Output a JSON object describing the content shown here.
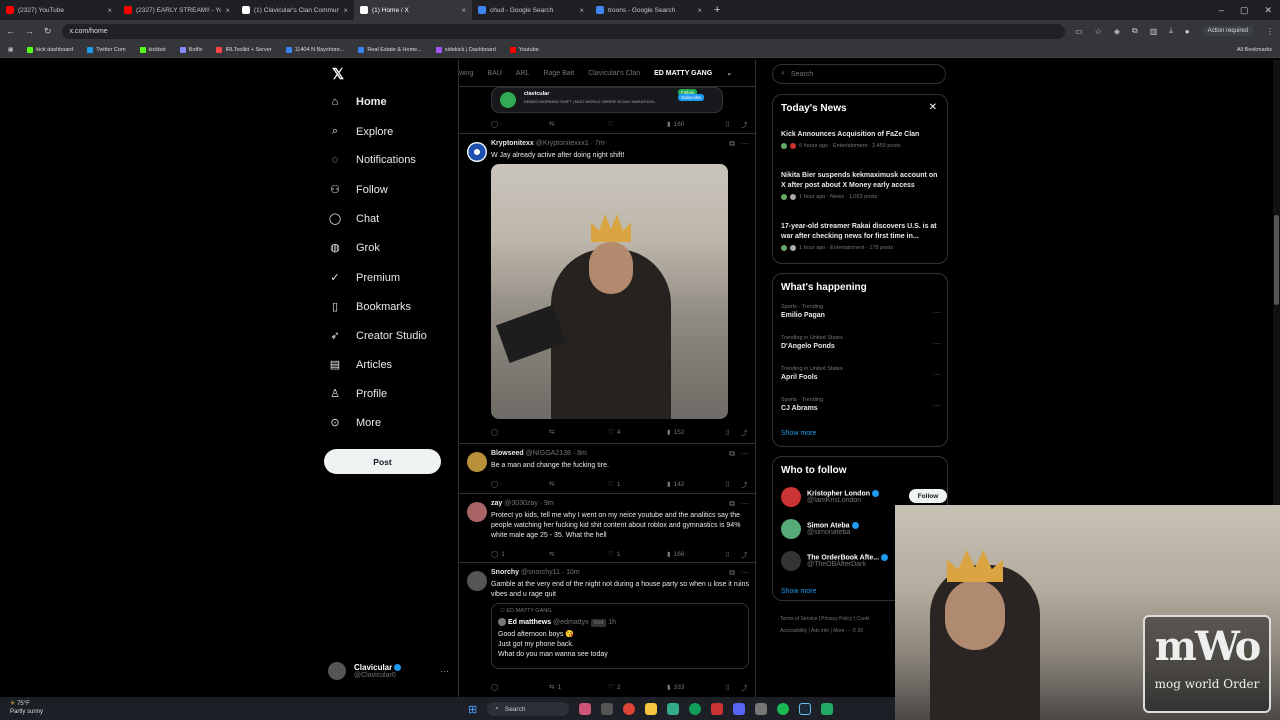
{
  "browser": {
    "tabs": [
      {
        "label": "(2327) YouTube",
        "color": "#ff0000"
      },
      {
        "label": "(2327) EARLY STREAM!! - Yo",
        "color": "#ff0000"
      },
      {
        "label": "(1) Clavicular's Clan Communit",
        "color": "#ffffff"
      },
      {
        "label": "(1) Home / X",
        "color": "#ffffff"
      },
      {
        "label": "chud - Google Search",
        "color": "#4285f4"
      },
      {
        "label": "troons - Google Search",
        "color": "#4285f4"
      }
    ],
    "url": "x.com/home",
    "action_required": "Action required",
    "bookmarks": [
      {
        "label": "kick dashboard",
        "color": "#53fc18"
      },
      {
        "label": "Twitter Com",
        "color": "#1d9bf0"
      },
      {
        "label": "kickbot",
        "color": "#53fc18"
      },
      {
        "label": "Botfix",
        "color": "#8888ff"
      },
      {
        "label": "IRLToolkit + Server",
        "color": "#ff4444"
      },
      {
        "label": "11404 N Bayshore...",
        "color": "#3b82f6"
      },
      {
        "label": "Real Estate & Home...",
        "color": "#3b82f6"
      },
      {
        "label": "sidekick | Dashboard",
        "color": "#a855f7"
      },
      {
        "label": "Youtube",
        "color": "#ff0000"
      }
    ],
    "all_bookmarks": "All Bookmarks"
  },
  "nav": {
    "items": [
      {
        "label": "Home",
        "icon": "home-icon",
        "glyph": "⌂"
      },
      {
        "label": "Explore",
        "icon": "search-icon",
        "glyph": "⌕"
      },
      {
        "label": "Notifications",
        "icon": "bell-icon",
        "glyph": "◌"
      },
      {
        "label": "Follow",
        "icon": "follow-icon",
        "glyph": "⚇"
      },
      {
        "label": "Chat",
        "icon": "chat-icon",
        "glyph": "◯"
      },
      {
        "label": "Grok",
        "icon": "grok-icon",
        "glyph": "◍"
      },
      {
        "label": "Premium",
        "icon": "premium-icon",
        "glyph": "✓"
      },
      {
        "label": "Bookmarks",
        "icon": "bookmark-icon",
        "glyph": "▯"
      },
      {
        "label": "Creator Studio",
        "icon": "rocket-icon",
        "glyph": "➶"
      },
      {
        "label": "Articles",
        "icon": "articles-icon",
        "glyph": "▤"
      },
      {
        "label": "Profile",
        "icon": "profile-icon",
        "glyph": "♙"
      },
      {
        "label": "More",
        "icon": "more-icon",
        "glyph": "⊙"
      }
    ],
    "post": "Post",
    "user": {
      "name": "Clavicular",
      "handle": "@Clavicular0"
    }
  },
  "feed": {
    "tabs": [
      "wing",
      "BAU",
      "ARL",
      "Rage Bait",
      "Clavicular's Clan",
      "ED MATTY GANG"
    ],
    "top_card": {
      "name": "clavicular",
      "sub": "DRADO MORNING SHIFT | MOO WORLD ORDER 30 DAY MARATHON...",
      "follow": "Follow",
      "subscribe": "Subscribe"
    },
    "top_views": "160",
    "tweets": [
      {
        "name": "Kryptonitexx",
        "handle": "@Kryptonitexxx1 · 7m",
        "text": "W Jay already active after doing night shift!",
        "likes": "4",
        "views": "152"
      },
      {
        "name": "Blowseed",
        "handle": "@NIGGA2138 · 8m",
        "text": "Be a man and change the fucking tire.",
        "likes": "1",
        "views": "142"
      },
      {
        "name": "zay",
        "handle": "@3030zay · 9m",
        "text": "Protect yo kids, tell me why I went on my neice youtube and the analitics say  the people watching her fucking kid shit content about roblox and gymnastics is 94% white male age 25 - 35. What the hell",
        "replies": "1",
        "likes": "1",
        "views": "166"
      },
      {
        "name": "Snorchy",
        "handle": "@snorchy11 · 10m",
        "text": "Gamble at the very end of the night not during a house party so when u lose it ruins vibes and u rage quit",
        "retweets": "1",
        "likes": "2",
        "views": "333"
      }
    ],
    "quote": {
      "community": "ED MATTY GANG",
      "name": "Ed matthews",
      "handle": "@edmattyx",
      "badge": "Mod",
      "time": "1h",
      "lines": [
        "Good afternoon boys 😘",
        "Just got my phone back.",
        "What do you man wanna see today"
      ]
    }
  },
  "sidebar": {
    "search_placeholder": "Search",
    "news_title": "Today's News",
    "news": [
      {
        "headline": "Kick Announces Acquisition of FaZe Clan",
        "meta": "6 hours ago · Entertainment · 2,459 posts"
      },
      {
        "headline": "Nikita Bier suspends kekmaximusk account on X after post about X Money early access",
        "meta": "1 hour ago · News · 1,053 posts"
      },
      {
        "headline": "17-year-old streamer Rakai discovers U.S. is at war after checking news for first time in...",
        "meta": "1 hour ago · Entertainment · 178 posts"
      }
    ],
    "happening_title": "What's happening",
    "trends": [
      {
        "context": "Sports · Trending",
        "name": "Emilio Pagan"
      },
      {
        "context": "Trending in United States",
        "name": "D'Angelo Ponds"
      },
      {
        "context": "Trending in United States",
        "name": "April Fools"
      },
      {
        "context": "Sports · Trending",
        "name": "CJ Abrams"
      }
    ],
    "show_more": "Show more",
    "who_title": "Who to follow",
    "who": [
      {
        "name": "Kristopher London",
        "handle": "@IamKrisLondon",
        "color": "#c33"
      },
      {
        "name": "Simon Ateba",
        "handle": "@simonateba",
        "color": "#5a7"
      },
      {
        "name": "The OrderBook Afte...",
        "handle": "@TheOBAfterDark",
        "color": "#333"
      }
    ],
    "follow_btn": "Follow",
    "footer1": "Terms of Service | Privacy Policy | Cooki",
    "footer2": "Accessibility | Ads info | More ··· © 20"
  },
  "overlay": {
    "logo_big": "mWo",
    "logo_small": "mog world Order"
  },
  "taskbar": {
    "temp": "75°F",
    "cond": "Partly sunny",
    "search": "Search"
  }
}
